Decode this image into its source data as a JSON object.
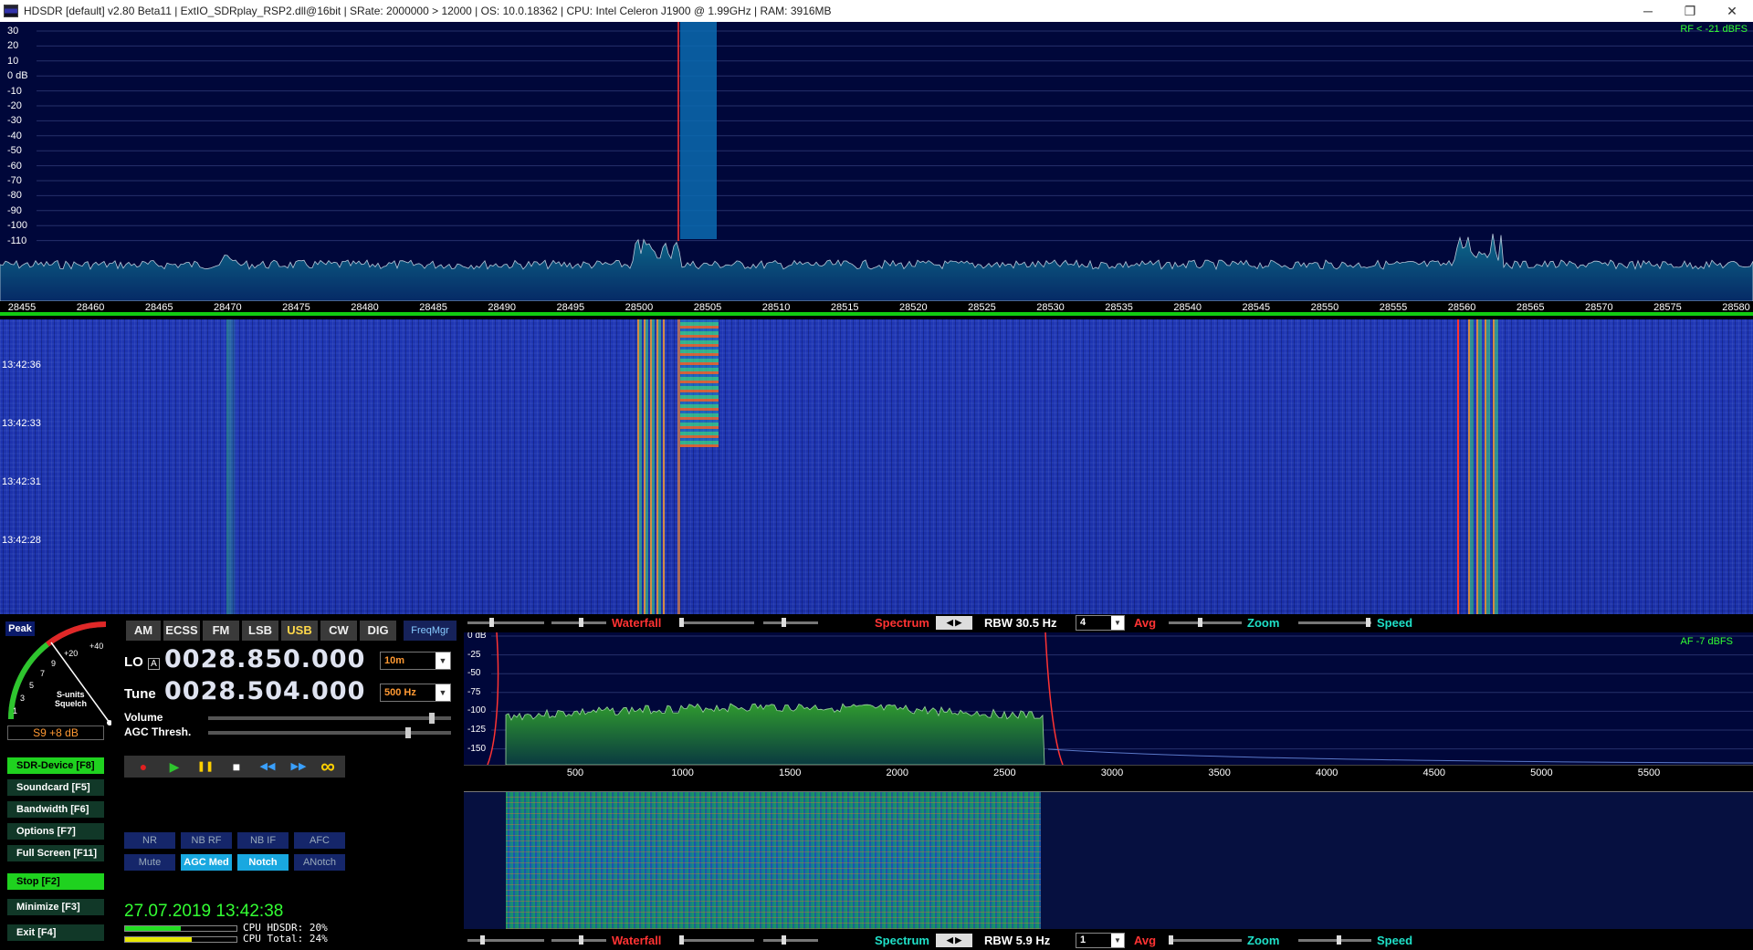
{
  "window": {
    "title": "HDSDR  [default]  v2.80 Beta11  |  ExtIO_SDRplay_RSP2.dll@16bit  |  SRate: 2000000 > 12000  |  OS: 10.0.18362  |  CPU: Intel Celeron  J1900  @ 1.99GHz  |  RAM: 3916MB",
    "min_glyph": "─",
    "restore_glyph": "❐",
    "close_glyph": "✕"
  },
  "rf_spectrum": {
    "db_labels": [
      "30",
      "20",
      "10",
      "0 dB",
      "-10",
      "-20",
      "-30",
      "-40",
      "-50",
      "-60",
      "-70",
      "-80",
      "-90",
      "-100",
      "-110"
    ],
    "level_text": "RF < -21 dBFS",
    "freq_ticks": [
      "28455",
      "28460",
      "28465",
      "28470",
      "28475",
      "28480",
      "28485",
      "28490",
      "28495",
      "28500",
      "28505",
      "28510",
      "28515",
      "28520",
      "28525",
      "28530",
      "28535",
      "28540",
      "28545",
      "28550",
      "28555",
      "28560",
      "28565",
      "28570",
      "28575",
      "28580"
    ]
  },
  "waterfall": {
    "timestamps": [
      "13:42:36",
      "13:42:33",
      "13:42:31",
      "13:42:28"
    ]
  },
  "smeter": {
    "peak_label": "Peak",
    "scale": [
      "1",
      "3",
      "5",
      "7",
      "9",
      "+20",
      "+40"
    ],
    "caption_1": "S-units",
    "caption_2": "Squelch",
    "reading": "S9 +8 dB"
  },
  "modes": [
    {
      "label": "AM",
      "active": false
    },
    {
      "label": "ECSS",
      "active": false
    },
    {
      "label": "FM",
      "active": false
    },
    {
      "label": "LSB",
      "active": false
    },
    {
      "label": "USB",
      "active": true
    },
    {
      "label": "CW",
      "active": false
    },
    {
      "label": "DIG",
      "active": false
    }
  ],
  "freqmgr_label": "FreqMgr",
  "lo": {
    "label": "LO",
    "sub": "A",
    "freq": "0028.850.000",
    "band": "10m"
  },
  "tune": {
    "label": "Tune",
    "freq": "0028.504.000",
    "bandwidth": "500 Hz"
  },
  "volume_label": "Volume",
  "agc_label": "AGC Thresh.",
  "volume_level": 0.93,
  "agc_level": 0.83,
  "transport": {
    "record": "●",
    "play": "▶",
    "pause": "❚❚",
    "stop": "■",
    "rewind": "◀◀",
    "forward": "▶▶",
    "loop": "∞"
  },
  "side_buttons": [
    {
      "label": "SDR-Device [F8]",
      "green": true
    },
    {
      "label": "Soundcard   [F5]",
      "green": false
    },
    {
      "label": "Bandwidth   [F6]",
      "green": false
    },
    {
      "label": "Options      [F7]",
      "green": false
    },
    {
      "label": "Full Screen  [F11]",
      "green": false
    },
    {
      "label": "Stop           [F2]",
      "green": true
    },
    {
      "label": "Minimize    [F3]",
      "green": false
    },
    {
      "label": "Exit           [F4]",
      "green": false
    }
  ],
  "dsp_buttons": [
    {
      "label": "NR",
      "active": false
    },
    {
      "label": "NB RF",
      "active": false
    },
    {
      "label": "NB IF",
      "active": false
    },
    {
      "label": "AFC",
      "active": false
    },
    {
      "label": "Mute",
      "active": false
    },
    {
      "label": "AGC Med",
      "active": true
    },
    {
      "label": "Notch",
      "active": true
    },
    {
      "label": "ANotch",
      "active": false
    }
  ],
  "datetime": "27.07.2019 13:42:38",
  "cpu": {
    "hdsdr_text": "CPU HDSDR:  20%",
    "total_text": "CPU Total:  24%",
    "hdsdr_level": 0.2,
    "total_level": 0.24,
    "hdsdr_color": "#22dd22",
    "total_color": "#e8e800"
  },
  "rf_controls": {
    "waterfall_label": "Waterfall",
    "spectrum_label": "Spectrum",
    "prev": "◀",
    "next": "▶",
    "rbw": "RBW  30.5 Hz",
    "avg_value": "4",
    "avg_label": "Avg",
    "zoom_label": "Zoom",
    "speed_label": "Speed"
  },
  "af_spectrum": {
    "db_labels": [
      "0 dB",
      "-25",
      "-50",
      "-75",
      "-100",
      "-125",
      "-150"
    ],
    "level_text": "AF  -7 dBFS",
    "ticks": [
      "500",
      "1000",
      "1500",
      "2000",
      "2500",
      "3000",
      "3500",
      "4000",
      "4500",
      "5000",
      "5500"
    ]
  },
  "af_controls": {
    "waterfall_label": "Waterfall",
    "spectrum_label": "Spectrum",
    "prev": "◀",
    "next": "▶",
    "rbw": "RBW  5.9 Hz",
    "avg_value": "1",
    "avg_label": "Avg",
    "zoom_label": "Zoom",
    "speed_label": "Speed"
  },
  "colors": {
    "accent_green": "#1fd21f",
    "mode_active": "#ffd84a",
    "dsp_active": "#19a8e0",
    "waterfall_red": "#ff3333",
    "spectrum_cyan": "#1fe0c8"
  }
}
